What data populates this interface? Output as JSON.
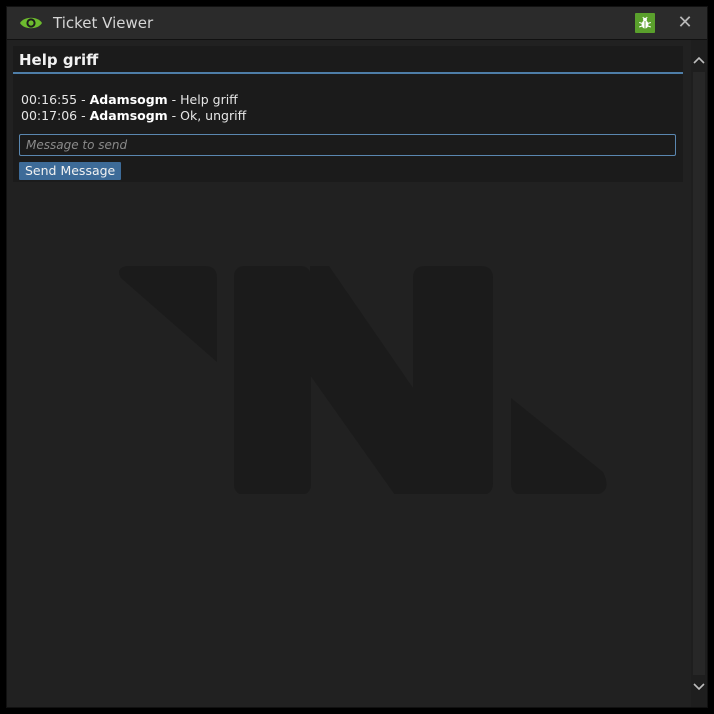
{
  "window": {
    "title": "Ticket Viewer",
    "close_symbol": "✕",
    "icons": {
      "title": "eye-icon",
      "bug": "bug-icon",
      "close": "close-icon",
      "scroll_up": "chevron-up-icon",
      "scroll_down": "chevron-down-icon",
      "watermark": "logo-watermark"
    }
  },
  "ticket": {
    "title": "Help griff",
    "messages": [
      {
        "time": "00:16:55",
        "separator": " - ",
        "user": "Adamsogm",
        "text": " - Help griff"
      },
      {
        "time": "00:17:06",
        "separator": " - ",
        "user": "Adamsogm",
        "text": " - Ok, ungriff"
      }
    ],
    "input_placeholder": "Message to send",
    "send_label": "Send Message"
  },
  "colors": {
    "accent_blue": "#3d6b98",
    "input_border": "#5a87b0",
    "eye_green": "#6dbb2e",
    "bug_green": "#5aa02c"
  }
}
